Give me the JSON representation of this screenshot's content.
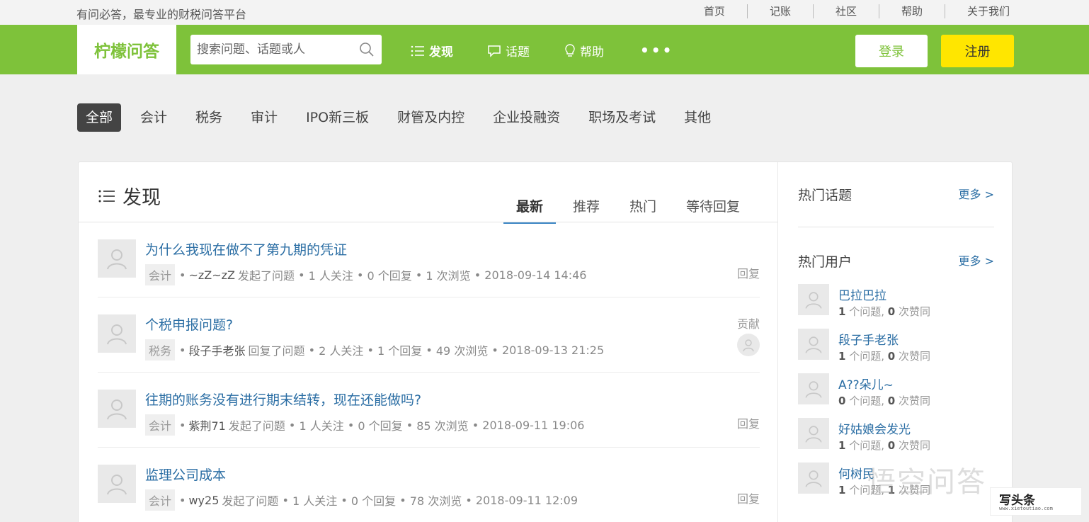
{
  "topbar": {
    "slogan": "有问必答，最专业的财税问答平台",
    "links": [
      "首页",
      "记账",
      "社区",
      "帮助",
      "关于我们"
    ]
  },
  "navbar": {
    "logo": "柠檬问答",
    "search_placeholder": "搜索问题、话题或人",
    "items": [
      "发现",
      "话题",
      "帮助"
    ],
    "more": "•••",
    "login": "登录",
    "register": "注册",
    "colors": {
      "brand_green": "#7ec23a",
      "register_yellow": "#ffe600",
      "link_blue": "#2b6ea4"
    }
  },
  "categories": [
    "全部",
    "会计",
    "税务",
    "审计",
    "IPO新三板",
    "财管及内控",
    "企业投融资",
    "职场及考试",
    "其他"
  ],
  "main": {
    "title": "发现",
    "tabs": [
      "最新",
      "推荐",
      "热门",
      "等待回复"
    ],
    "questions": [
      {
        "title": "为什么我现在做不了第九期的凭证",
        "tag": "会计",
        "author": "~zZ~zZ",
        "action": "发起了问题",
        "follows": "1 人关注",
        "replies": "0 个回复",
        "views": "1 次浏览",
        "time": "2018-09-14 14:46",
        "right": "回复"
      },
      {
        "title": "个税申报问题?",
        "tag": "税务",
        "author": "段子手老张",
        "action": "回复了问题",
        "follows": "2 人关注",
        "replies": "1 个回复",
        "views": "49 次浏览",
        "time": "2018-09-13 21:25",
        "right": "贡献"
      },
      {
        "title": "往期的账务没有进行期末结转，现在还能做吗?",
        "tag": "会计",
        "author": "紫荆71",
        "action": "发起了问题",
        "follows": "1 人关注",
        "replies": "0 个回复",
        "views": "85 次浏览",
        "time": "2018-09-11 19:06",
        "right": "回复"
      },
      {
        "title": "监理公司成本",
        "tag": "会计",
        "author": "wy25",
        "action": "发起了问题",
        "follows": "1 人关注",
        "replies": "0 个回复",
        "views": "78 次浏览",
        "time": "2018-09-11 12:09",
        "right": "回复"
      }
    ]
  },
  "sidebar": {
    "hot_topics": "热门话题",
    "hot_users": "热门用户",
    "more": "更多 >",
    "users": [
      {
        "name": "巴拉巴拉",
        "questions": "1",
        "likes": "0",
        "q_label": " 个问题, ",
        "l_label": " 次赞同"
      },
      {
        "name": "段子手老张",
        "questions": "1",
        "likes": "0",
        "q_label": " 个问题, ",
        "l_label": " 次赞同"
      },
      {
        "name": "A??朵儿~",
        "questions": "0",
        "likes": "0",
        "q_label": " 个问题, ",
        "l_label": " 次赞同"
      },
      {
        "name": "好姑娘会发光",
        "questions": "1",
        "likes": "0",
        "q_label": " 个问题, ",
        "l_label": " 次赞同"
      },
      {
        "name": "何树民",
        "questions": "1",
        "likes": "1",
        "q_label": " 个问题, ",
        "l_label": " 次赞同"
      }
    ]
  },
  "watermark": {
    "text": "悟空问答",
    "badge_main": "写头条",
    "badge_sub": "www.xietoutiao.com"
  }
}
